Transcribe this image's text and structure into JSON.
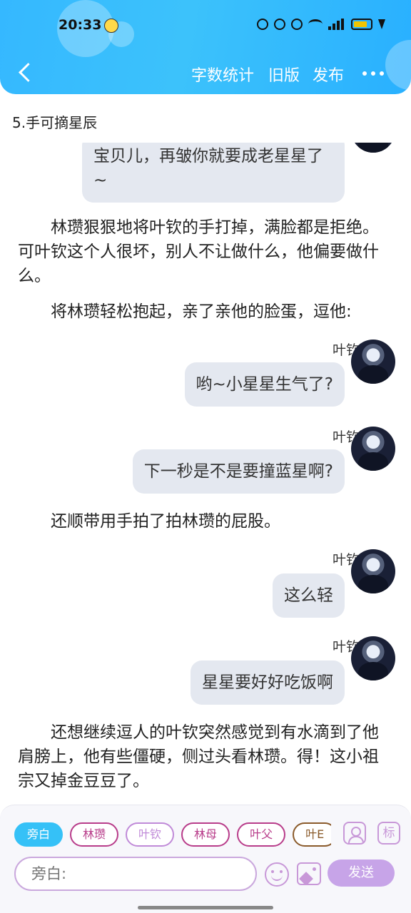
{
  "status_bar": {
    "time": "20:33",
    "network": "4G"
  },
  "nav": {
    "back_icon": "chevron-left-icon",
    "actions": [
      "字数统计",
      "旧版",
      "发布"
    ],
    "more_icon": "more-dots-icon"
  },
  "chapter": {
    "title": "5.手可摘星辰"
  },
  "story": [
    {
      "type": "bubble",
      "text": "宝贝儿，再皱你就要成老星星了~"
    },
    {
      "type": "narration",
      "text": "林瓒狠狠地将叶钦的手打掉，满脸都是拒绝。可叶钦这个人很坏，别人不让做什么，他偏要做什么。"
    },
    {
      "type": "narration",
      "text": "将林瓒轻松抱起，亲了亲他的脸蛋，逗他:"
    },
    {
      "type": "dialogue",
      "speaker": "叶钦",
      "text": "哟~小星星生气了?"
    },
    {
      "type": "dialogue",
      "speaker": "叶钦",
      "text": "下一秒是不是要撞蓝星啊?"
    },
    {
      "type": "narration",
      "text": "还顺带用手拍了拍林瓒的屁股。"
    },
    {
      "type": "dialogue",
      "speaker": "叶钦",
      "text": "这么轻"
    },
    {
      "type": "dialogue",
      "speaker": "叶钦",
      "text": "星星要好好吃饭啊"
    },
    {
      "type": "narration",
      "text": "还想继续逗人的叶钦突然感觉到有水滴到了他肩膀上，他有些僵硬，侧过头看林瓒。得！这小祖宗又掉金豆豆了。"
    }
  ],
  "composer": {
    "roles": [
      {
        "label": "旁白",
        "active": true,
        "color": "#35c1f7"
      },
      {
        "label": "林瓒",
        "active": false,
        "color": "#b83c8a"
      },
      {
        "label": "叶钦",
        "active": false,
        "color": "#c08ad8"
      },
      {
        "label": "林母",
        "active": false,
        "color": "#b83c8a"
      },
      {
        "label": "叶父",
        "active": false,
        "color": "#b83c8a"
      },
      {
        "label": "叶E",
        "active": false,
        "color": "#8a5a2a"
      }
    ],
    "side_icons": [
      "person-card-icon",
      "tag-icon"
    ],
    "tag_label": "标",
    "input_placeholder": "旁白:",
    "emoji_icon": "emoji-icon",
    "image_icon": "image-icon",
    "send_label": "发送"
  },
  "colors": {
    "header": "#35b8ff",
    "bubble": "#e4e8f0",
    "accent": "#c7a4e8"
  }
}
